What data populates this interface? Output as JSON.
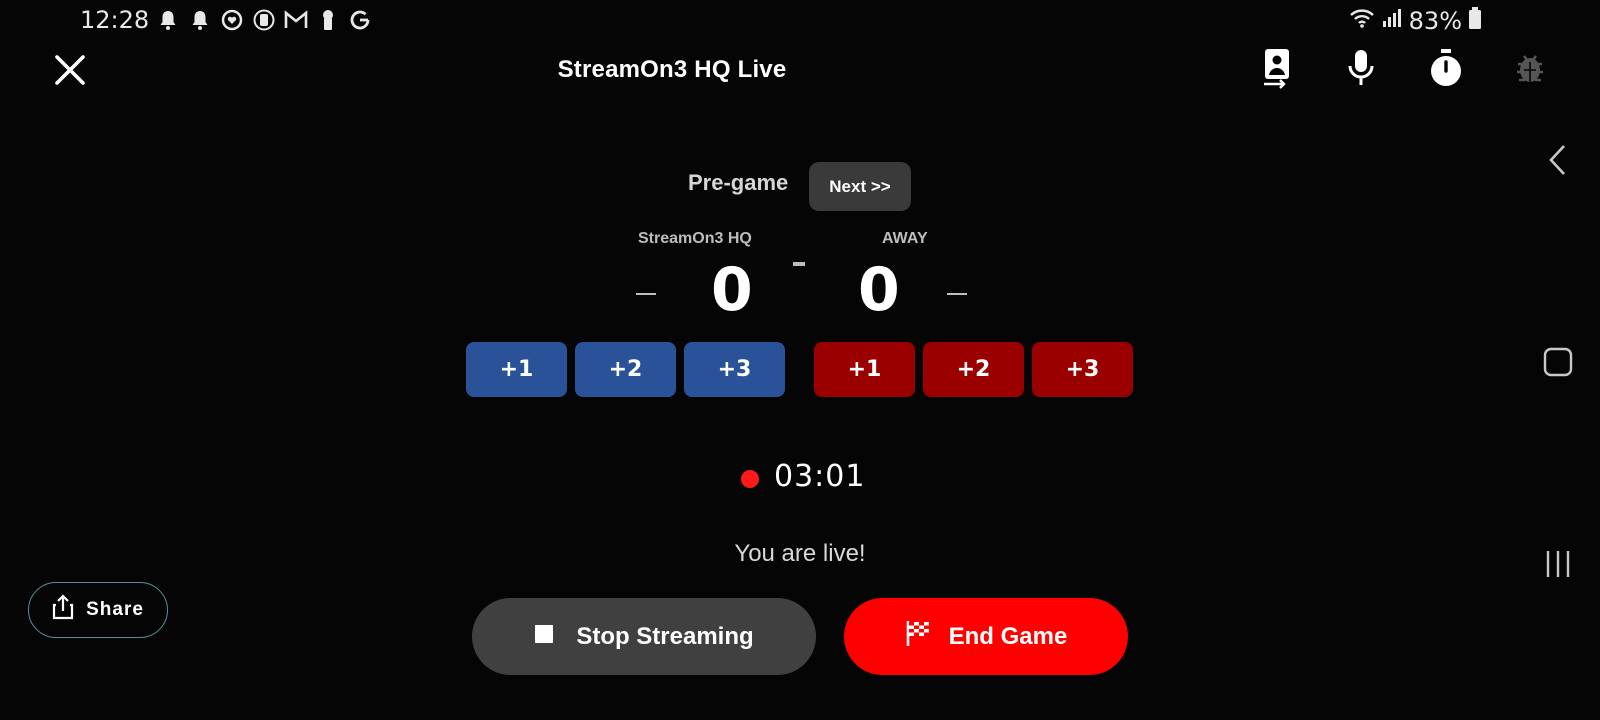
{
  "status_bar": {
    "time": "12:28",
    "left_icons": [
      "notification-bell-icon",
      "notification-bell-icon",
      "heart-sync-icon",
      "app-circle-icon",
      "gmail-icon",
      "keyhole-icon",
      "google-icon"
    ],
    "battery": "83%",
    "right_icons": [
      "wifi-icon",
      "signal-icon",
      "battery-icon"
    ]
  },
  "header": {
    "title": "StreamOn3 HQ Live",
    "actions": [
      "switch-camera-icon",
      "microphone-icon",
      "stopwatch-icon",
      "bug-icon"
    ]
  },
  "game": {
    "period": "Pre-game",
    "next_label": "Next >>",
    "home": {
      "name": "StreamOn3 HQ",
      "score": "0"
    },
    "away": {
      "name": "AWAY",
      "score": "0"
    },
    "point_buttons": [
      "+1",
      "+2",
      "+3"
    ]
  },
  "recording": {
    "timer": "03:01",
    "status_text": "You are live!"
  },
  "buttons": {
    "share": "Share",
    "stop": "Stop Streaming",
    "end": "End Game"
  },
  "colors": {
    "home_team": "#2a5298",
    "away_team": "#9b0000",
    "end_game": "#ff0000",
    "stop_streaming": "#404040",
    "record_dot": "#ff1a1a"
  }
}
